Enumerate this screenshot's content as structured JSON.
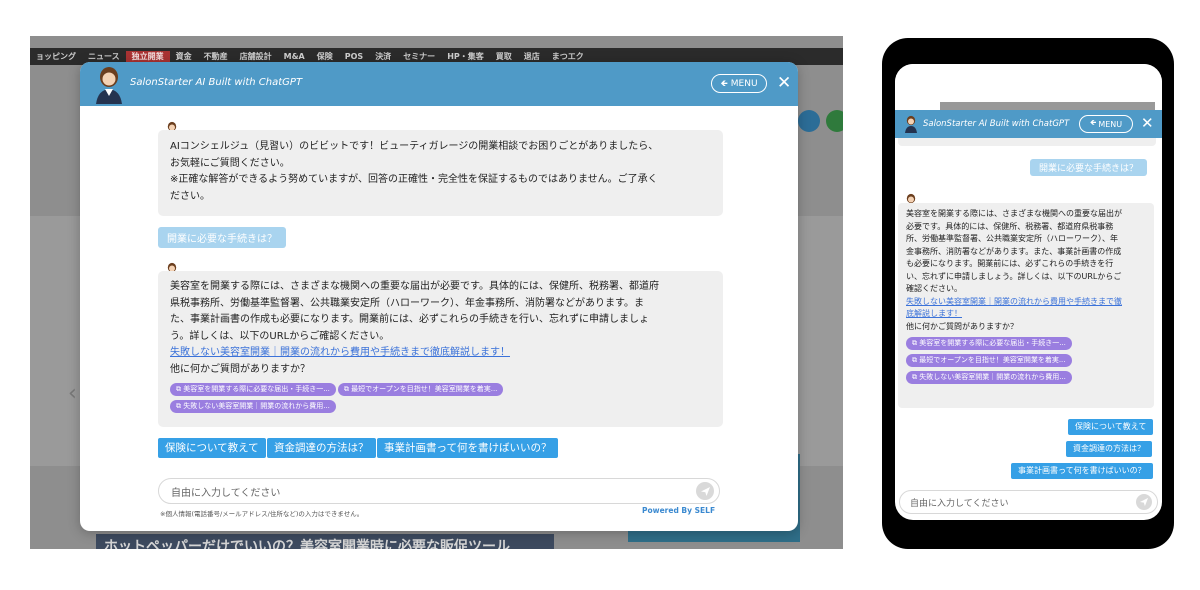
{
  "desktop": {
    "nav_items": [
      "ョッピング",
      "ニュース",
      "独立開業",
      "資金",
      "不動産",
      "店舗設計",
      "M&A",
      "保険",
      "POS",
      "決済",
      "セミナー",
      "HP・集客",
      "買取",
      "退店",
      "まつエク"
    ],
    "nav_active_index": 2,
    "background_title": "ホットペッパーだけでいいの？美容室開業時に必要な販促ツール"
  },
  "chat": {
    "header_title": "SalonStarter AI Built with ChatGPT",
    "menu_label": "MENU",
    "greeting_lines": [
      "AIコンシェルジュ（見習い）のビビットです！ビューティガレージの開業相談でお困りごとがありましたら、",
      "お気軽にご質問ください。",
      "※正確な解答ができるよう努めていますが、回答の正確性・完全性を保証するものではありません。ご了承く",
      "ださい。"
    ],
    "user_question": "開業に必要な手続きは？",
    "answer_lines": [
      "美容室を開業する際には、さまざまな機関への重要な届出が必要です。具体的には、保健所、税務署、都道府",
      "県税事務所、労働基準監督署、公共職業安定所（ハローワーク）、年金事務所、消防署などがあります。ま",
      "た、事業計画書の作成も必要になります。開業前には、必ずこれらの手続きを行い、忘れずに申請しましょ",
      "う。詳しくは、以下のURLからご確認ください。"
    ],
    "answer_link": "失敗しない美容室開業｜開業の流れから費用や手続きまで徹底解説します！",
    "answer_followup": "他に何かご質問がありますか？",
    "ref_links": [
      "美容室を開業する際に必要な届出・手続き一...",
      "最短でオープンを目指せ！美容室開業を着実...",
      "失敗しない美容室開業｜開業の流れから費用..."
    ],
    "suggestions": [
      "保険について教えて",
      "資金調達の方法は？",
      "事業計画書って何を書けばいいの？"
    ],
    "input_placeholder": "自由に入力してください",
    "disclaimer": "※個人情報(電話番号/メールアドレス/住所など)の入力はできません。",
    "powered_by": "Powered By SELF"
  },
  "mobile": {
    "header_title": "SalonStarter AI Built with ChatGPT",
    "menu_label": "MENU",
    "user_question": "開業に必要な手続きは？",
    "answer_lines": [
      "美容室を開業する際には、さまざまな機関への重要な届出が",
      "必要です。具体的には、保健所、税務署、都道府県税事務",
      "所、労働基準監督署、公共職業安定所（ハローワーク）、年",
      "金事務所、消防署などがあります。また、事業計画書の作成",
      "も必要になります。開業前には、必ずこれらの手続きを行",
      "い、忘れずに申請しましょう。詳しくは、以下のURLからご",
      "確認ください。"
    ],
    "answer_link_lines": [
      "失敗しない美容室開業｜開業の流れから費用や手続きまで徹",
      "底解説します！"
    ],
    "answer_followup": "他に何かご質問がありますか？",
    "ref_links": [
      "美容室を開業する際に必要な届出・手続き一...",
      "最短でオープンを目指せ！美容室開業を着実...",
      "失敗しない美容室開業｜開業の流れから費用..."
    ],
    "suggestions": [
      "保険について教えて",
      "資金調達の方法は？",
      "事業計画書って何を書けばいいの？"
    ],
    "input_placeholder": "自由に入力してください"
  },
  "colors": {
    "header": "#4f9ac7",
    "suggestion": "#36a0e6",
    "user_pill": "#a9d4ef",
    "ref_pill": "#9a7ee0",
    "bubble": "#efefef",
    "link": "#3b72d9",
    "powered": "#3a89d0"
  },
  "icons": {
    "avatar": "avatar-icon",
    "menu": "back-arrow-icon",
    "close": "close-icon",
    "send": "send-icon",
    "ref": "external-link-icon"
  }
}
